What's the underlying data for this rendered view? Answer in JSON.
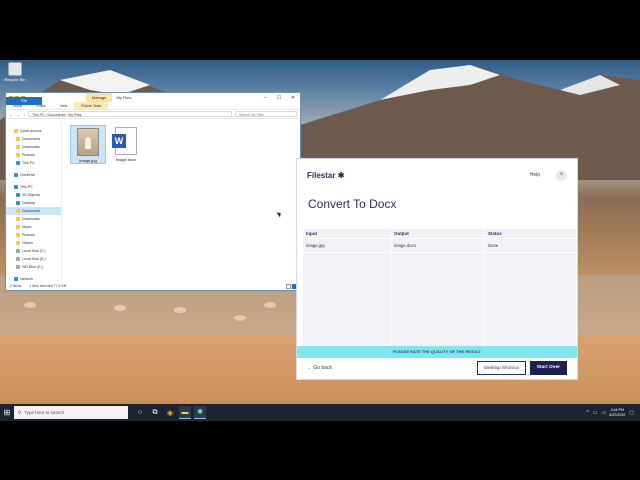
{
  "desktop": {
    "recycle_bin_label": "Recycle Bin"
  },
  "explorer": {
    "manage_label": "Manage",
    "window_title": "My Files",
    "ribbon_tabs": [
      "File",
      "Home",
      "Share",
      "View",
      "Picture Tools"
    ],
    "address_path": "This PC  ›  Documents  ›  My Files",
    "search_placeholder": "Search My Files",
    "nav_items": [
      {
        "label": "Quick access",
        "level": 1,
        "icon": "star-icon"
      },
      {
        "label": "Documents",
        "level": 2,
        "icon": "documents-icon"
      },
      {
        "label": "Downloads",
        "level": 2,
        "icon": "downloads-icon"
      },
      {
        "label": "Pictures",
        "level": 2,
        "icon": "pictures-icon"
      },
      {
        "label": "This PC",
        "level": 2,
        "icon": "pc-icon"
      },
      {
        "label": "OneDrive",
        "level": 1,
        "icon": "cloud-icon"
      },
      {
        "label": "This PC",
        "level": 1,
        "icon": "pc-icon"
      },
      {
        "label": "3D Objects",
        "level": 2,
        "icon": "cube-icon"
      },
      {
        "label": "Desktop",
        "level": 2,
        "icon": "desktop-icon"
      },
      {
        "label": "Documents",
        "level": 2,
        "icon": "documents-icon",
        "selected": true
      },
      {
        "label": "Downloads",
        "level": 2,
        "icon": "downloads-icon"
      },
      {
        "label": "Music",
        "level": 2,
        "icon": "music-icon"
      },
      {
        "label": "Pictures",
        "level": 2,
        "icon": "pictures-icon"
      },
      {
        "label": "Videos",
        "level": 2,
        "icon": "videos-icon"
      },
      {
        "label": "Local Disk (C:)",
        "level": 2,
        "icon": "drive-icon"
      },
      {
        "label": "Local Disk (D:)",
        "level": 2,
        "icon": "drive-icon"
      },
      {
        "label": "WD Blue (E:)",
        "level": 2,
        "icon": "drive-icon"
      },
      {
        "label": "Network",
        "level": 1,
        "icon": "network-icon"
      }
    ],
    "files": [
      {
        "name": "image.jpg",
        "type": "image",
        "selected": true
      },
      {
        "name": "image.docx",
        "type": "word"
      }
    ],
    "status_items": "2 items",
    "status_selected": "1 item selected  77.5 KB"
  },
  "filestar": {
    "logo": "Filestar",
    "help_label": "Help",
    "close_label": "×",
    "title": "Convert To Docx",
    "columns": [
      {
        "header": "Input",
        "value": "image.jpg"
      },
      {
        "header": "Output",
        "value": "image.docx"
      },
      {
        "header": "Status",
        "value": "Done"
      }
    ],
    "banner": "PLEASE RATE THE QUALITY OF THE RESULT",
    "back_label": "Go back",
    "desktop_shortcut_label": "Desktop Shortcut",
    "start_over_label": "Start Over"
  },
  "taskbar": {
    "search_placeholder": "Type here to search",
    "time": "4:44 PM",
    "date": "6/22/2020"
  }
}
